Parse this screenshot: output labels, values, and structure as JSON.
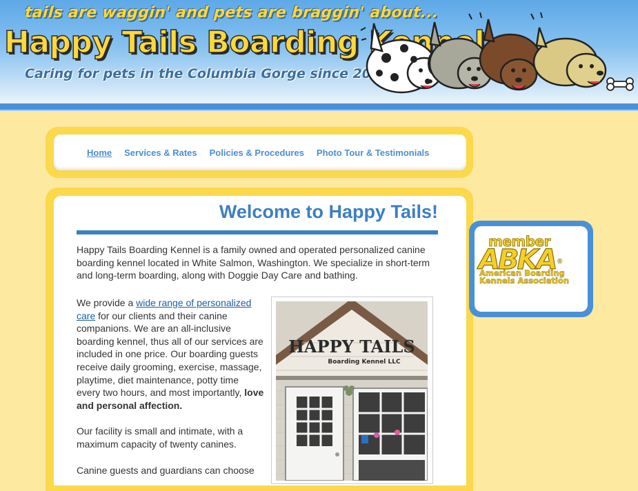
{
  "header": {
    "tagline": "tails are waggin' and pets are braggin' about...",
    "title": "Happy Tails Boarding Kennel",
    "subtagline": "Caring for pets in the Columbia Gorge since 2003"
  },
  "nav": {
    "items": [
      {
        "label": "Home",
        "active": true
      },
      {
        "label": "Services & Rates"
      },
      {
        "label": "Policies & Procedures"
      },
      {
        "label": "Photo Tour & Testimonials"
      }
    ]
  },
  "main": {
    "title": "Welcome to Happy Tails!",
    "intro": "Happy Tails Boarding Kennel is a family owned and operated personalized canine boarding kennel located in White Salmon, Washington. We specialize in short-term and long-term boarding, along with Doggie Day Care and bathing.",
    "p2_before": "We provide a ",
    "p2_link": "wide range of personalized care",
    "p2_after": " for our clients and their canine companions. We are an all-inclusive boarding kennel, thus all of our services are included in one price. Our boarding guests receive daily grooming, exercise, massage, playtime, diet maintenance, potty time every two hours, and most importantly, ",
    "p2_bold": "love and personal affection.",
    "p3": "Our facility is small and intimate, with a maximum capacity of twenty canines.",
    "p4": "Canine guests and guardians can choose"
  },
  "photo": {
    "sign_line1": "HAPPY TAILS",
    "sign_line2": "Boarding Kennel LLC"
  },
  "badge": {
    "member": "member",
    "abka": "ABKA",
    "reg": "®",
    "org_line1": "American Boarding",
    "org_line2": "Kennels Association"
  },
  "colors": {
    "page_bg": "#fde9a0",
    "panel_yellow": "#fbd84c",
    "accent_blue": "#3c7fc3",
    "nav_link": "#4a8fd0"
  }
}
